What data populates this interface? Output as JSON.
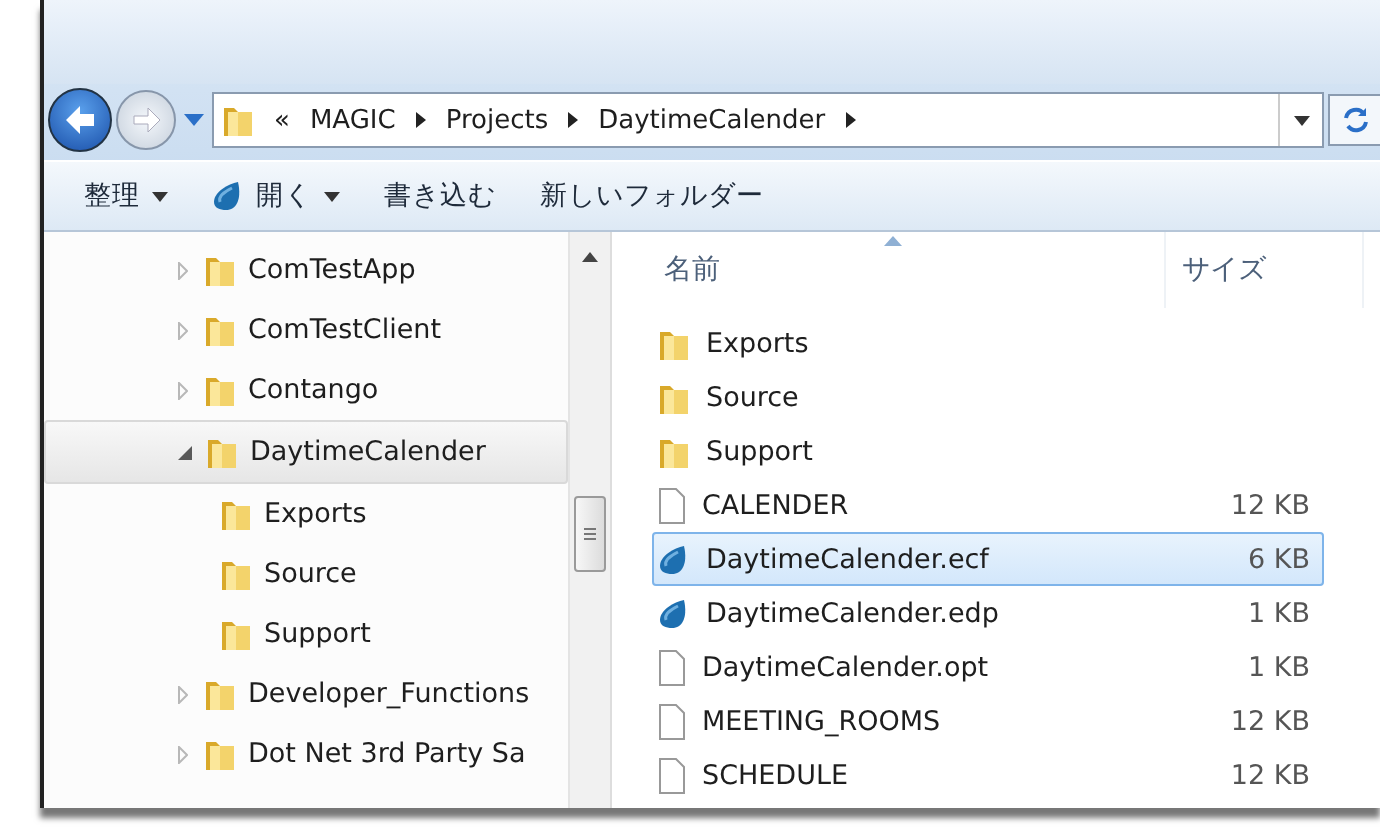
{
  "address": {
    "crumbs": [
      "«",
      "MAGIC",
      "Projects",
      "DaytimeCalender"
    ]
  },
  "toolbar": [
    {
      "label": "整理",
      "icon": false,
      "menu": true
    },
    {
      "label": "開く",
      "icon": true,
      "menu": true
    },
    {
      "label": "書き込む",
      "icon": false,
      "menu": false
    },
    {
      "label": "新しいフォルダー",
      "icon": false,
      "menu": false
    }
  ],
  "tree": [
    {
      "label": "ComTestApp",
      "expanded": false,
      "selected": false
    },
    {
      "label": "ComTestClient",
      "expanded": false,
      "selected": false
    },
    {
      "label": "Contango",
      "expanded": false,
      "selected": false
    },
    {
      "label": "DaytimeCalender",
      "expanded": true,
      "selected": true,
      "children": [
        {
          "label": "Exports"
        },
        {
          "label": "Source"
        },
        {
          "label": "Support"
        }
      ]
    },
    {
      "label": "Developer_Functions",
      "expanded": false,
      "selected": false
    },
    {
      "label": "Dot Net 3rd Party Sa",
      "expanded": false,
      "selected": false
    }
  ],
  "columns": [
    "名前",
    "サイズ"
  ],
  "files": [
    {
      "kind": "folder",
      "name": "Exports",
      "selected": false
    },
    {
      "kind": "folder",
      "name": "Source",
      "selected": false
    },
    {
      "kind": "folder",
      "name": "Support",
      "selected": false
    },
    {
      "kind": "file",
      "name": "CALENDER",
      "size": "12 KB",
      "selected": false
    },
    {
      "kind": "app",
      "name": "DaytimeCalender.ecf",
      "size": "6 KB",
      "selected": true
    },
    {
      "kind": "app",
      "name": "DaytimeCalender.edp",
      "size": "1 KB",
      "selected": false
    },
    {
      "kind": "file",
      "name": "DaytimeCalender.opt",
      "size": "1 KB",
      "selected": false
    },
    {
      "kind": "file",
      "name": "MEETING_ROOMS",
      "size": "12 KB",
      "selected": false
    },
    {
      "kind": "file",
      "name": "SCHEDULE",
      "size": "12 KB",
      "selected": false
    }
  ]
}
